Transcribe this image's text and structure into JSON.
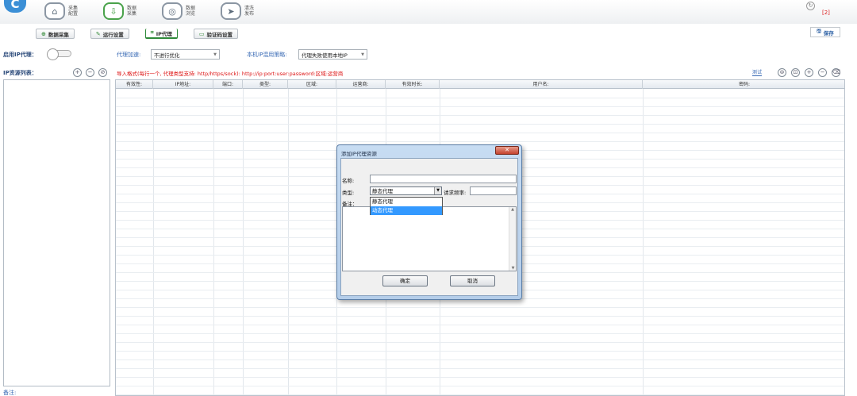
{
  "topnav": {
    "items": [
      {
        "icon": "home-icon",
        "glyph": "⌂",
        "line1": "采集",
        "line2": "配置",
        "active": false
      },
      {
        "icon": "download-icon",
        "glyph": "⇩",
        "line1": "数据",
        "line2": "采集",
        "active": true
      },
      {
        "icon": "layers-icon",
        "glyph": "◎",
        "line1": "数据",
        "line2": "浏览",
        "active": false
      },
      {
        "icon": "send-icon",
        "glyph": "➤",
        "line1": "清洗",
        "line2": "发布",
        "active": false
      }
    ],
    "count": "[2]"
  },
  "subnav": {
    "data_collect": "数据采集",
    "run_settings": "运行设置",
    "ip_proxy": "IP代理",
    "captcha_settings": "验证码设置",
    "save": "保存"
  },
  "settings": {
    "enable_label": "启用IP代理：",
    "accel_label": "代理加速:",
    "accel_value": "不进行优化",
    "strategy_label": "本机IP混用策略:",
    "strategy_value": "代理失败使用本地IP",
    "source_label": "IP资源列表：",
    "hint": "导入格式(每行一个, 代理类型支持: http/https/sock):   http://ip:port:user:password:区域:运营商",
    "test": "测试",
    "note": "备注:"
  },
  "table": {
    "columns": [
      "有效性:",
      "IP地址:",
      "端口:",
      "类型:",
      "区域:",
      "运营商:",
      "有效时长:",
      "用户名:",
      "密码:"
    ]
  },
  "dialog": {
    "title": "添加IP代理资源",
    "close": "✕",
    "name_label": "名称:",
    "type_label": "类型:",
    "type_value": "静态代理",
    "freq_label": "请求频率:",
    "remark_label": "备注：",
    "options": [
      "静态代理",
      "动态代理"
    ],
    "ok": "确定",
    "cancel": "取消"
  }
}
